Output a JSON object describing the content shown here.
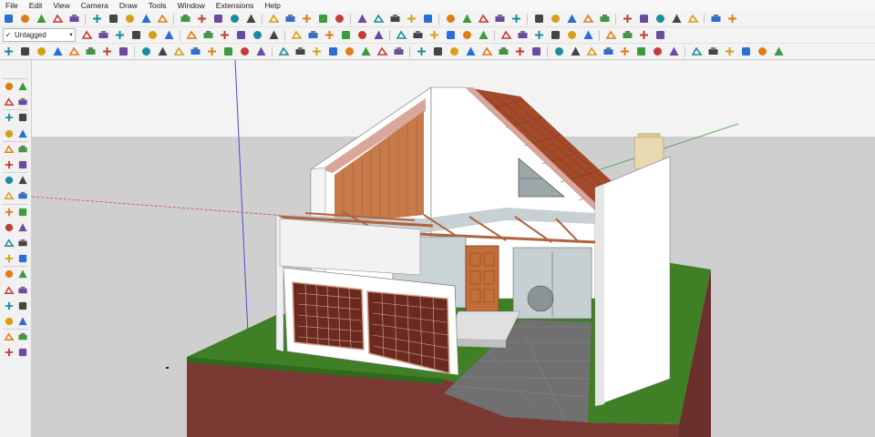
{
  "menu": [
    "File",
    "Edit",
    "View",
    "Camera",
    "Draw",
    "Tools",
    "Window",
    "Extensions",
    "Help"
  ],
  "tag_select": {
    "value": "Untagged",
    "check_icon": "check-icon",
    "caret_icon": "chevron-down-icon"
  },
  "toolbar1_icons": [
    "new-icon",
    "open-icon",
    "cut-icon",
    "copy-icon",
    "paste-icon",
    "erase-icon",
    "undo-icon",
    "redo-icon",
    "print-icon",
    "model-info-icon",
    "pencil-icon",
    "sandbox-icon",
    "smoove-icon",
    "stamp-icon",
    "drape-icon",
    "add-detail-icon",
    "flip-edge-icon",
    "scale-icon",
    "extension-warehouse-icon",
    "refresh-icon",
    "component-icon",
    "components-icon",
    "add-location-icon",
    "tree-icon",
    "terrain-icon",
    "photo-texture-icon",
    "checker-icon",
    "settings-icon",
    "mail-icon",
    "info-icon",
    "slot-icon",
    "slot-icon",
    "slot-icon",
    "slot-icon",
    "solar-icon",
    "push-icon",
    "push-icon",
    "flag-icon",
    "soap-icon",
    "gem-icon",
    "plant-icon",
    "plugin-icon"
  ],
  "toolbar2_icons": [
    "iso-icon",
    "top-icon",
    "front-icon",
    "right-icon",
    "back-icon",
    "left-icon",
    "xray-icon",
    "back-edges-icon",
    "wireframe-icon",
    "hidden-line-icon",
    "shaded-icon",
    "shaded-texture-icon",
    "monochrome-icon",
    "house-icon",
    "house-icon",
    "house-icon",
    "house-icon",
    "house-icon",
    "section-plane-icon",
    "section-cut-icon",
    "section-fill-icon",
    "display-section-icon",
    "materials-icon",
    "materials-icon",
    "materials-icon",
    "materials-icon",
    "materials-icon",
    "materials-icon",
    "axes-icon",
    "orbit-icon",
    "pan-icon",
    "zoom-icon",
    "help-icon",
    "settings-icon"
  ],
  "toolbar3_icons": [
    "dynamic-icon",
    "dynamic-icon",
    "dynamic-icon",
    "dynamic-icon",
    "dynamic-icon",
    "dynamic-icon",
    "dynamic-icon",
    "dynamic-icon",
    "dynamic-icon",
    "dynamic-icon",
    "dynamic-icon",
    "dynamic-icon",
    "dynamic-icon",
    "dynamic-icon",
    "dynamic-icon",
    "dynamic-icon",
    "dynamic-icon",
    "dynamic-icon",
    "dynamic-icon",
    "dynamic-icon",
    "dynamic-icon",
    "dynamic-icon",
    "dynamic-icon",
    "dynamic-icon",
    "dynamic-icon",
    "dynamic-icon",
    "dynamic-icon",
    "dynamic-icon",
    "dynamic-icon",
    "dynamic-icon",
    "dynamic-icon",
    "dynamic-icon",
    "dynamic-icon",
    "dynamic-icon",
    "dynamic-icon",
    "dynamic-icon",
    "dynamic-icon",
    "dynamic-icon",
    "dynamic-icon",
    "dynamic-icon",
    "round-corner-icon",
    "bake-icon",
    "layout-icon",
    "grid-icon",
    "green-icon",
    "grid-icon"
  ],
  "left_tool_icons": [
    "select-icon",
    "component-icon",
    "paint-bucket-icon",
    "eraser-icon",
    "line-icon",
    "freehand-icon",
    "rectangle-icon",
    "rotated-rect-icon",
    "circle-icon",
    "polygon-icon",
    "arc-icon",
    "pie-icon",
    "move-icon",
    "push-pull-icon",
    "rotate-icon",
    "follow-me-icon",
    "scale-icon",
    "offset-icon",
    "tape-measure-icon",
    "dimension-icon",
    "protractor-icon",
    "text-icon",
    "axes-icon",
    "3d-text-icon",
    "orbit-icon",
    "pan-icon",
    "zoom-icon",
    "zoom-window-icon",
    "zoom-extents-icon",
    "previous-icon",
    "position-camera-icon",
    "look-around-icon",
    "walk-icon",
    "section-plane-icon",
    "sandbox-from-contours-icon",
    "sandbox-from-scratch-icon"
  ],
  "colors": {
    "sky": "#f2f2f2",
    "ground": "#cfcfcf",
    "grass": "#3e7d24",
    "soil": "#7d3a34",
    "wall": "#ffffff",
    "roof": "#a34a2b",
    "wood": "#c77a4a",
    "trim": "#d9a78f",
    "paving": "#6f6f6f",
    "axis_red": "#c83a3a",
    "axis_green": "#2f9a2f",
    "axis_blue": "#3a3ad0"
  }
}
